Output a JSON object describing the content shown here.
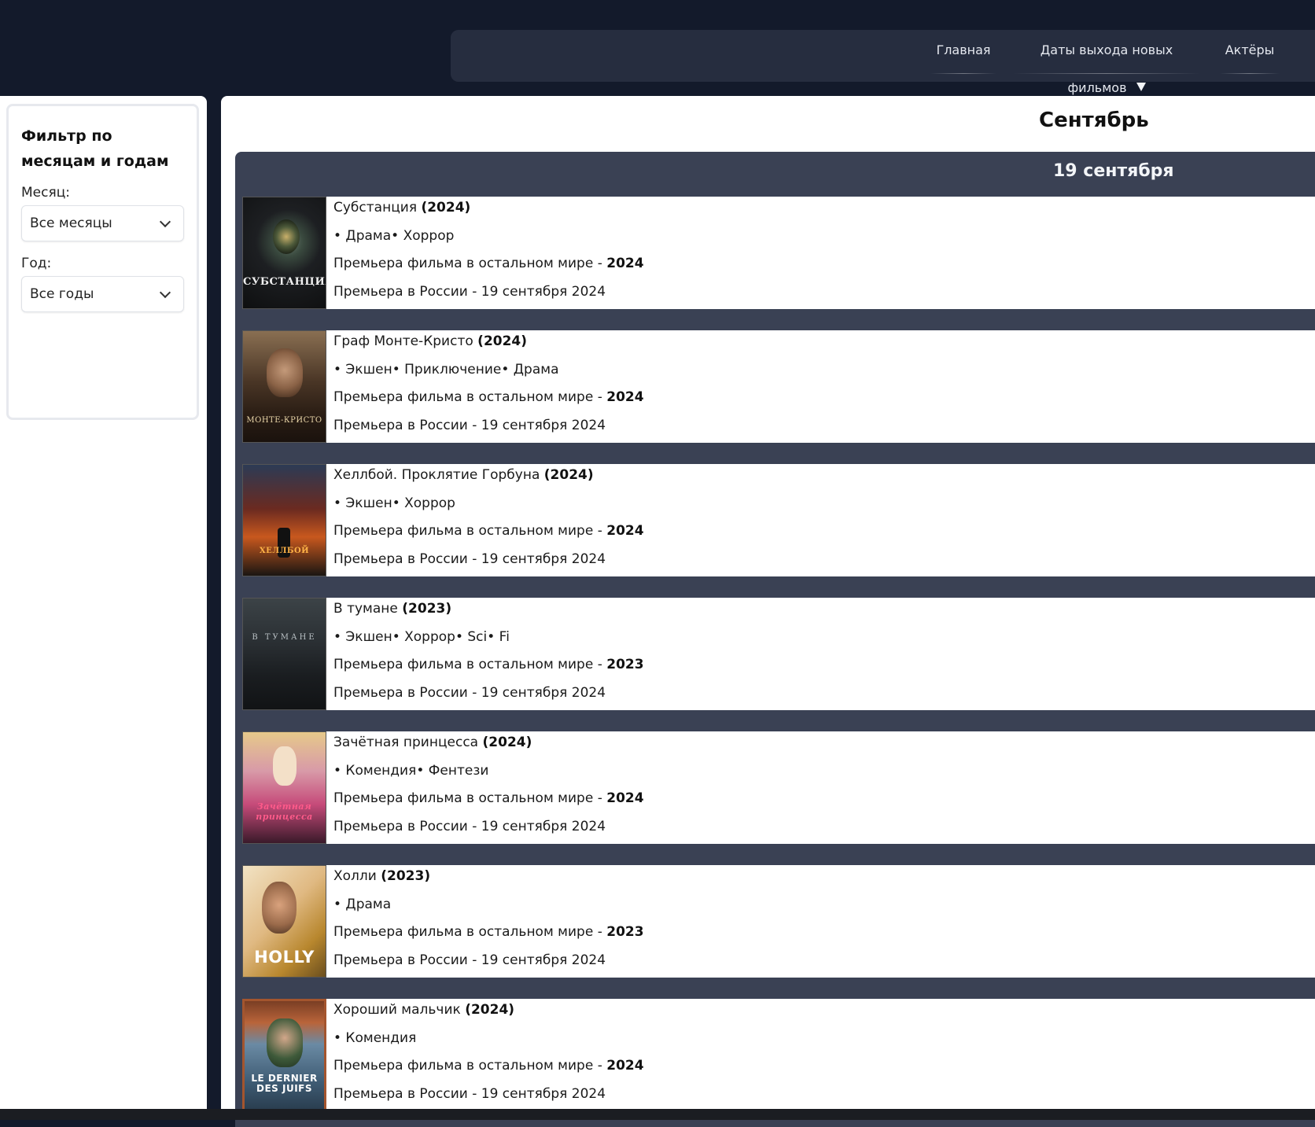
{
  "nav": {
    "home": "Главная",
    "release_dates": "Даты выхода новых фильмов",
    "actors": "Актёры"
  },
  "sidebar": {
    "title": "Фильтр по месяцам и годам",
    "month_label": "Месяц:",
    "month_value": "Все месяцы",
    "year_label": "Год:",
    "year_value": "Все годы"
  },
  "main": {
    "month_title": "Сентябрь",
    "date_header": "19 сентября",
    "world_premiere_prefix": "Премьера фильма в остальном мире -",
    "russia_premiere_prefix": "Премьера в России -",
    "movies": [
      {
        "title": "Субстанция",
        "year": "(2024)",
        "genres": "• Драма• Хоррор",
        "world_year": "2024",
        "russia_date": "19 сентября 2024",
        "poster_text": "СУБСТАНЦИЯ"
      },
      {
        "title": "Граф Монте-Кристо",
        "year": "(2024)",
        "genres": "• Экшен• Приключение• Драма",
        "world_year": "2024",
        "russia_date": "19 сентября 2024",
        "poster_text": "МОНТЕ-КРИСТО"
      },
      {
        "title": "Хеллбой. Проклятие Горбуна",
        "year": "(2024)",
        "genres": "• Экшен• Хоррор",
        "world_year": "2024",
        "russia_date": "19 сентября 2024",
        "poster_text": "ХЕЛЛБОЙ"
      },
      {
        "title": "В тумане",
        "year": "(2023)",
        "genres": "• Экшен• Хоррор• Sci• Fi",
        "world_year": "2023",
        "russia_date": "19 сентября 2024",
        "poster_text": "В ТУМАНЕ"
      },
      {
        "title": "Зачётная принцесса",
        "year": "(2024)",
        "genres": "• Комендия• Фентези",
        "world_year": "2024",
        "russia_date": "19 сентября 2024",
        "poster_text": "Зачётная принцесса"
      },
      {
        "title": "Холли",
        "year": "(2023)",
        "genres": "• Драма",
        "world_year": "2023",
        "russia_date": "19 сентября 2024",
        "poster_text": "HOLLY"
      },
      {
        "title": "Хороший мальчик",
        "year": "(2024)",
        "genres": "• Комендия",
        "world_year": "2024",
        "russia_date": "19 сентября 2024",
        "poster_text": "LE DERNIER DES JUIFS"
      }
    ]
  },
  "colors": {
    "page_bg": "#131a2b",
    "navbar_bg": "#262d3f",
    "date_block_bg": "#3a4154",
    "card_bg": "#ffffff"
  }
}
